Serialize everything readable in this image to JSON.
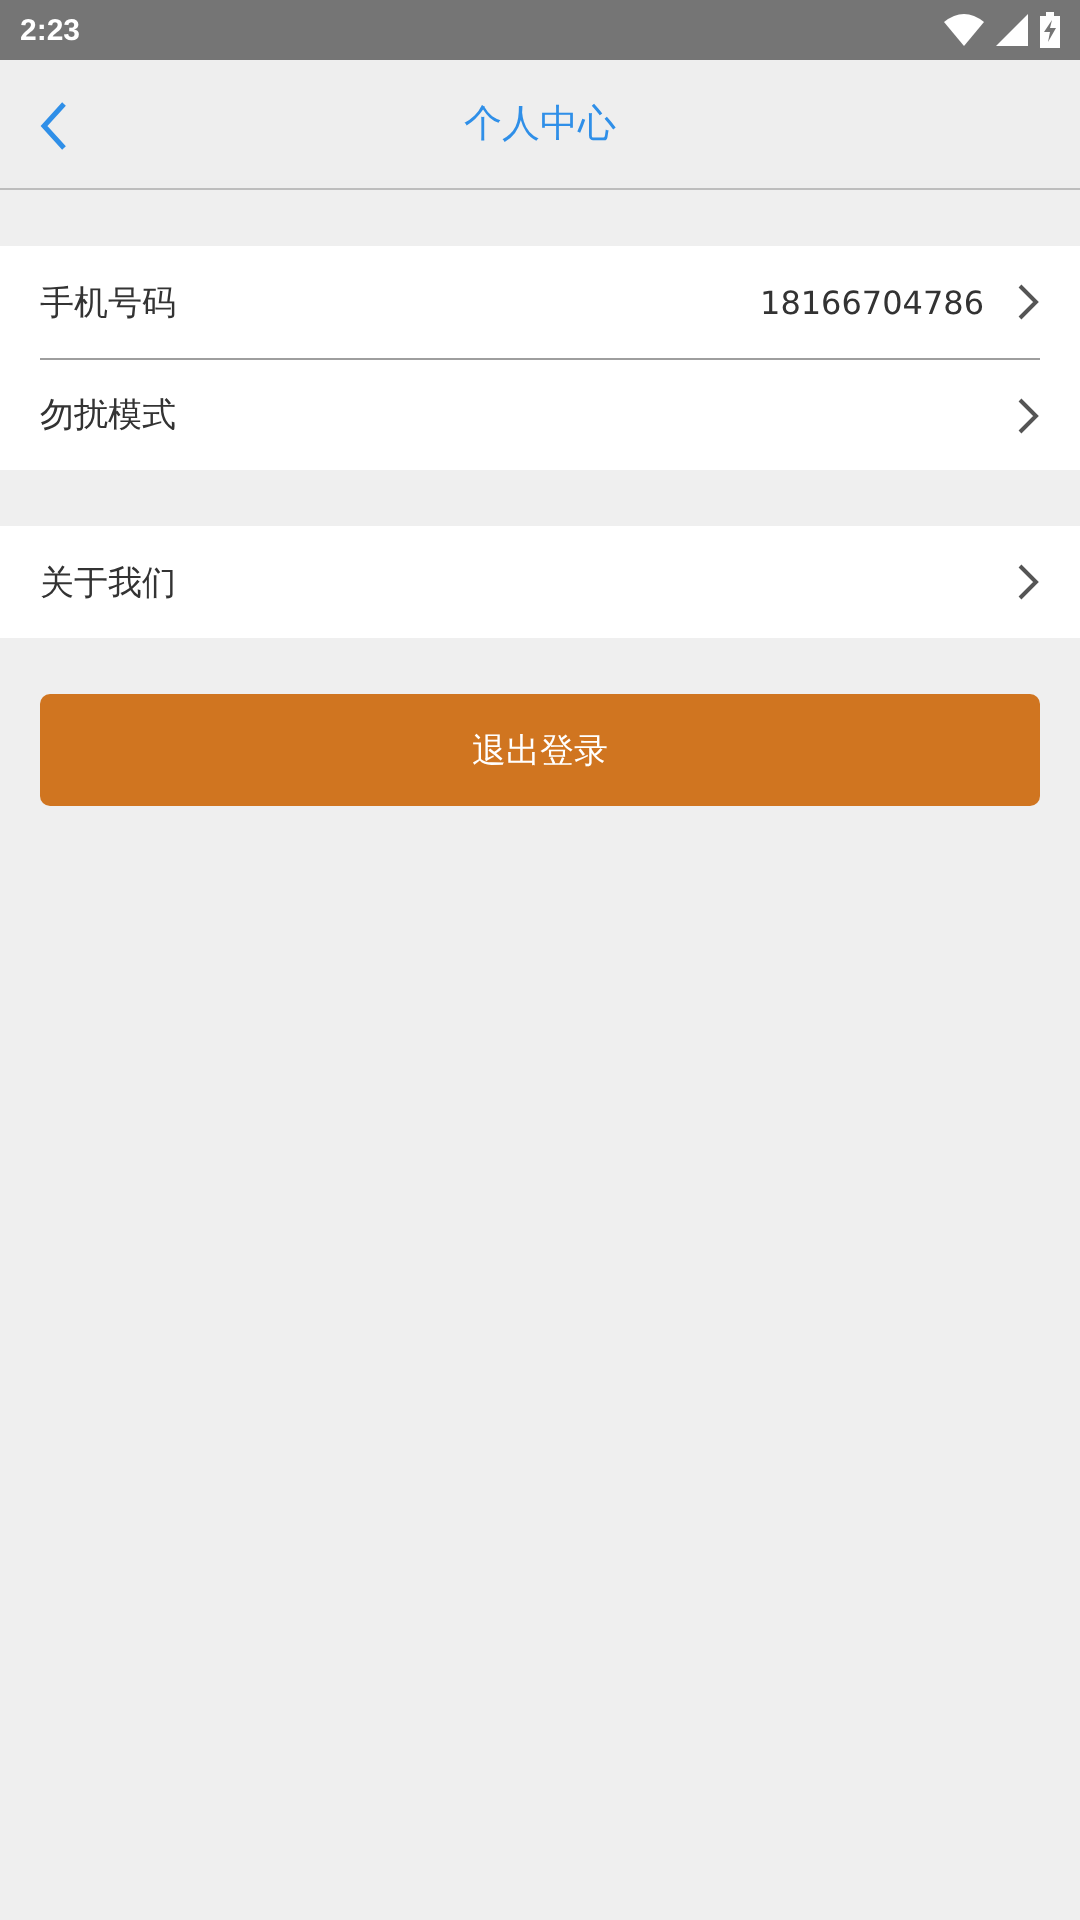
{
  "status_bar": {
    "time": "2:23"
  },
  "header": {
    "title": "个人中心"
  },
  "groups": [
    {
      "items": [
        {
          "label": "手机号码",
          "value": "18166704786"
        },
        {
          "label": "勿扰模式"
        }
      ]
    },
    {
      "items": [
        {
          "label": "关于我们"
        }
      ]
    }
  ],
  "logout_button": "退出登录"
}
